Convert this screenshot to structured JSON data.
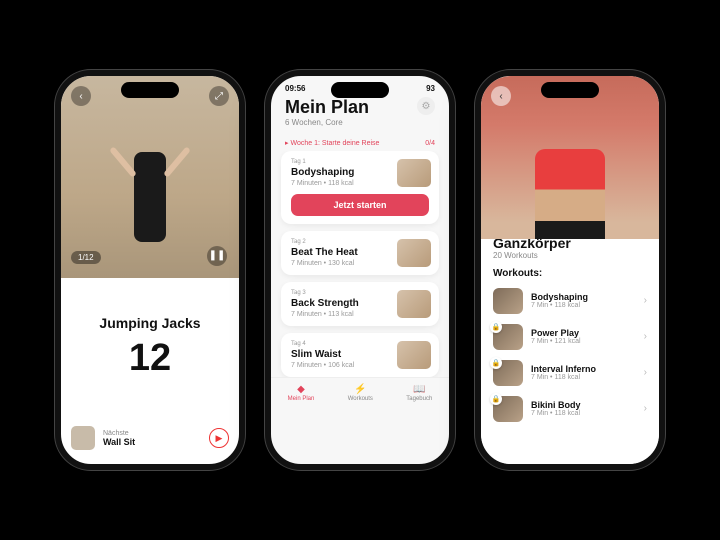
{
  "phone1": {
    "exercise_name": "Jumping Jacks",
    "reps": "12",
    "counter": "1/12",
    "next_label": "Nächste",
    "next_name": "Wall Sit"
  },
  "phone2": {
    "status_time": "09:56",
    "status_right": "93",
    "title": "Mein Plan",
    "subtitle": "6 Wochen, Core",
    "week_label": "Woche 1: Starte deine Reise",
    "week_progress": "0/4",
    "cta": "Jetzt starten",
    "days": [
      {
        "tag": "Tag 1",
        "name": "Bodyshaping",
        "meta": "7 Minuten • 118 kcal"
      },
      {
        "tag": "Tag 2",
        "name": "Beat The Heat",
        "meta": "7 Minuten • 130 kcal"
      },
      {
        "tag": "Tag 3",
        "name": "Back Strength",
        "meta": "7 Minuten • 113 kcal"
      },
      {
        "tag": "Tag 4",
        "name": "Slim Waist",
        "meta": "7 Minuten • 106 kcal"
      }
    ],
    "tabs": [
      "Mein Plan",
      "Workouts",
      "Tagebuch"
    ]
  },
  "phone3": {
    "category": "Ganzkörper",
    "count": "20 Workouts",
    "section": "Workouts:",
    "items": [
      {
        "name": "Bodyshaping",
        "meta": "7 Min • 118 kcal",
        "locked": false
      },
      {
        "name": "Power Play",
        "meta": "7 Min • 121 kcal",
        "locked": true
      },
      {
        "name": "Interval Inferno",
        "meta": "7 Min • 118 kcal",
        "locked": true
      },
      {
        "name": "Bikini Body",
        "meta": "7 Min • 118 kcal",
        "locked": true
      }
    ]
  }
}
